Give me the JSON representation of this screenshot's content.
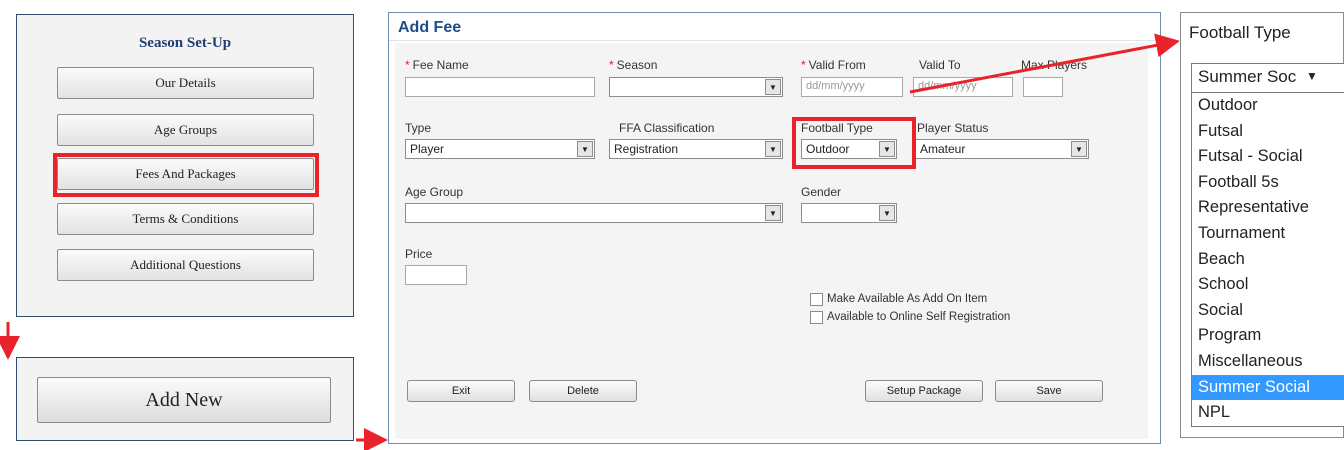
{
  "setup": {
    "title": "Season Set-Up",
    "buttons": [
      "Our Details",
      "Age Groups",
      "Fees And Packages",
      "Terms & Conditions",
      "Additional Questions"
    ],
    "add_new": "Add New"
  },
  "fee_form": {
    "title": "Add Fee",
    "fields": {
      "fee_name": "Fee Name",
      "season": "Season",
      "valid_from": "Valid From",
      "valid_to": "Valid To",
      "max_players": "Max Players",
      "date_placeholder": "dd/mm/yyyy",
      "type": "Type",
      "type_value": "Player",
      "ffa_classification": "FFA Classification",
      "ffa_value": "Registration",
      "football_type": "Football Type",
      "football_type_value": "Outdoor",
      "player_status": "Player Status",
      "player_status_value": "Amateur",
      "age_group": "Age Group",
      "gender": "Gender",
      "price": "Price"
    },
    "checkboxes": [
      "Make Available As Add On Item",
      "Available to Online Self Registration"
    ],
    "buttons": {
      "exit": "Exit",
      "delete": "Delete",
      "setup_package": "Setup Package",
      "save": "Save"
    }
  },
  "football_type_dropdown": {
    "label": "Football Type",
    "current": "Summer Soc",
    "options": [
      "Outdoor",
      "Futsal",
      "Futsal - Social",
      "Football 5s",
      "Representative",
      "Tournament",
      "Beach",
      "School",
      "Social",
      "Program",
      "Miscellaneous",
      "Summer Social",
      "NPL"
    ],
    "selected": "Summer Social"
  },
  "colors": {
    "highlight": "#e8242a",
    "title_blue": "#1d4d8c",
    "required": "#e02020",
    "selected_option": "#3399ff"
  }
}
